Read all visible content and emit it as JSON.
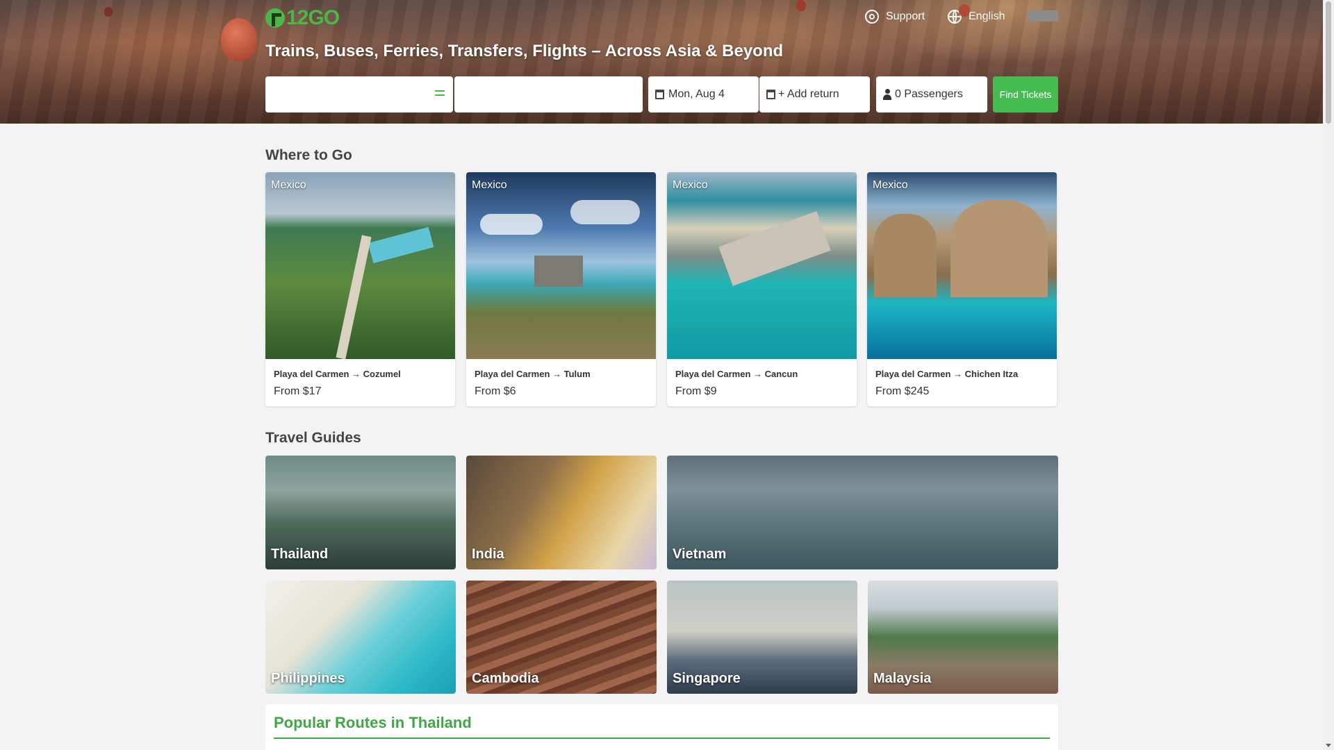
{
  "brand": {
    "logo_text": "12GO"
  },
  "nav": {
    "support_label": "Support",
    "language_label": "English"
  },
  "hero": {
    "headline": "Trains, Buses, Ferries, Transfers, Flights – Across Asia & Beyond"
  },
  "search": {
    "from_value": "",
    "to_value": "",
    "date_label": "Mon, Aug 4",
    "return_label": "+ Add return",
    "passengers_label": "0 Passengers",
    "find_label": "Find Tickets"
  },
  "where_to_go": {
    "title": "Where to Go",
    "cards": [
      {
        "country": "Mexico",
        "route": "Playa del Carmen → Cozumel",
        "price": "From $17"
      },
      {
        "country": "Mexico",
        "route": "Playa del Carmen → Tulum",
        "price": "From $6"
      },
      {
        "country": "Mexico",
        "route": "Playa del Carmen → Cancun",
        "price": "From $9"
      },
      {
        "country": "Mexico",
        "route": "Playa del Carmen → Chichen Itza",
        "price": "From $245"
      }
    ]
  },
  "travel_guides": {
    "title": "Travel Guides",
    "items": [
      {
        "label": "Thailand"
      },
      {
        "label": "India"
      },
      {
        "label": "Vietnam"
      },
      {
        "label": "Philippines"
      },
      {
        "label": "Cambodia"
      },
      {
        "label": "Singapore"
      },
      {
        "label": "Malaysia"
      }
    ]
  },
  "popular_routes": {
    "title": "Popular Routes in Thailand"
  },
  "colors": {
    "brand_green": "#4cb648",
    "button_green": "#46bb52",
    "heading_green": "#3ea845"
  },
  "icons": [
    "logo-icon",
    "support-icon",
    "globe-icon",
    "swap-icon",
    "calendar-icon",
    "passenger-icon"
  ]
}
